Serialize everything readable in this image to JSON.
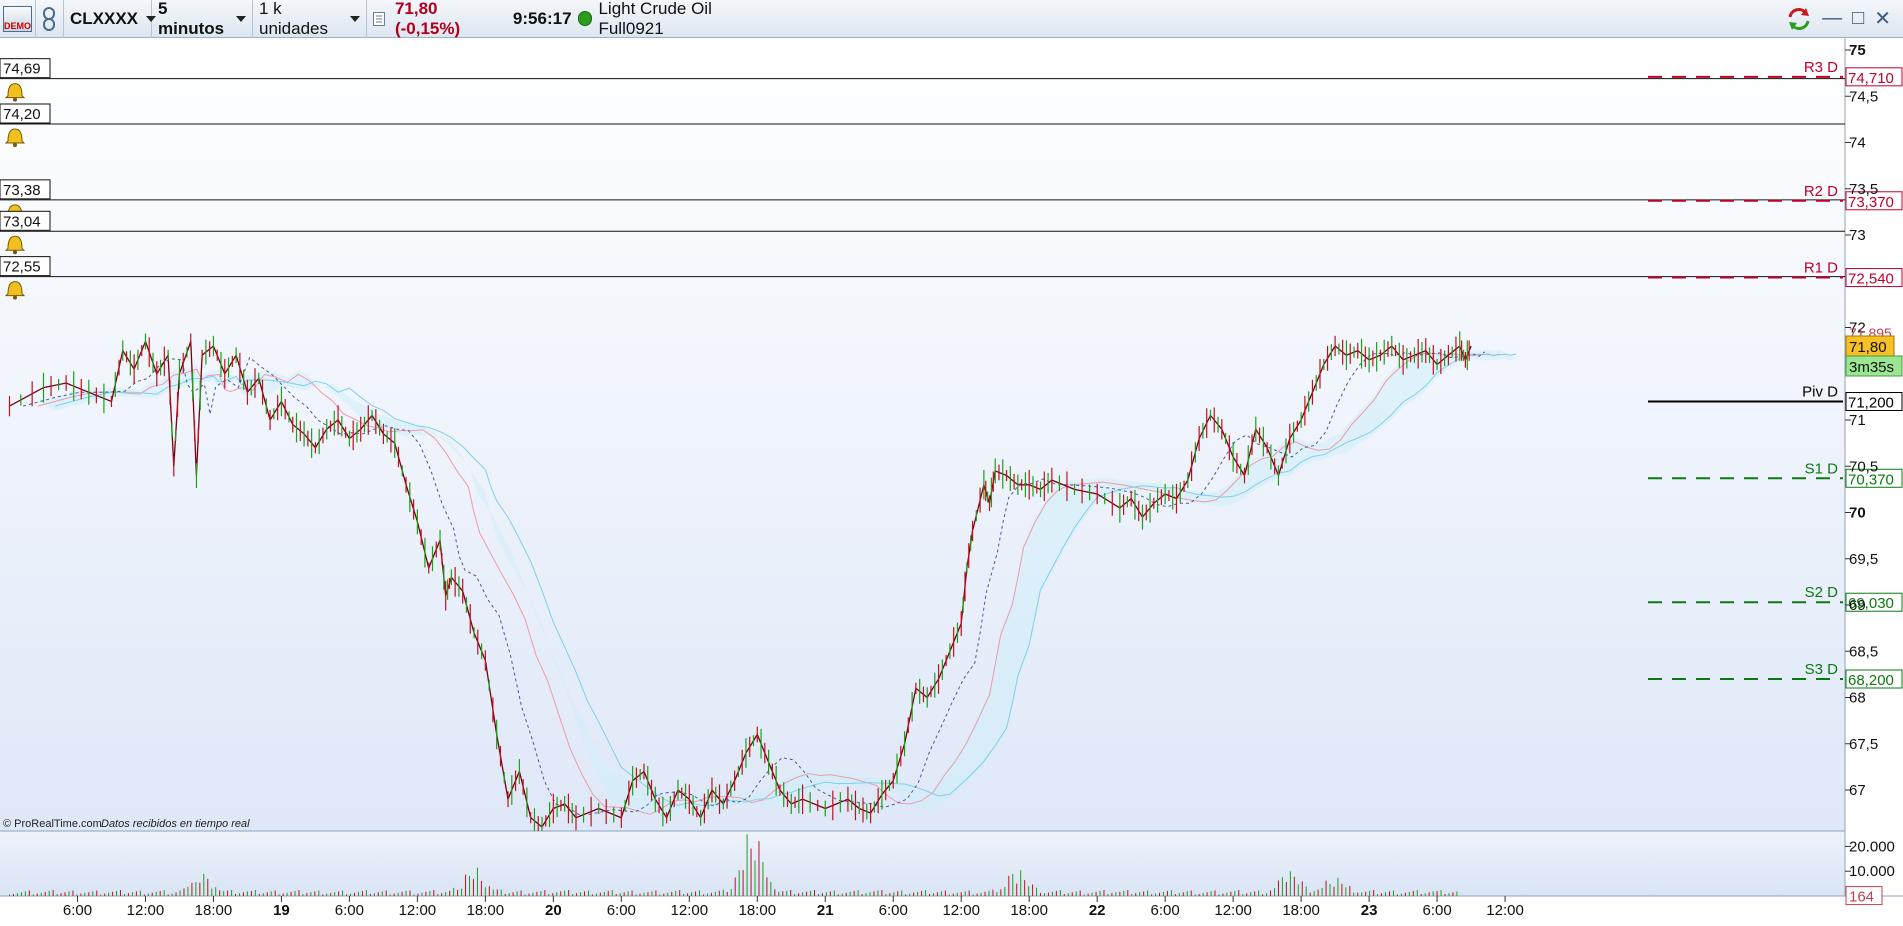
{
  "toolbar": {
    "demo_label": "DEMO",
    "link_icon": "chain-link-icon",
    "instrument": "CLXXXX",
    "timeframe": "5 minutos",
    "units": "1 k unidades",
    "price": "71,80 (-0,15%)",
    "time": "9:56:17",
    "instrument_name": "Light Crude Oil Full0921",
    "window_icons": [
      "refresh-icon",
      "minimize-icon",
      "maximize-icon",
      "close-icon"
    ]
  },
  "attribution": {
    "source": "© ProRealTime.com",
    "status": "Datos recibidos en tiempo real"
  },
  "alerts": [
    {
      "label": "74,69",
      "price": 74.69
    },
    {
      "label": "74,20",
      "price": 74.2
    },
    {
      "label": "73,38",
      "price": 73.38
    },
    {
      "label": "73,04",
      "price": 73.04
    },
    {
      "label": "72,55",
      "price": 72.55
    }
  ],
  "pivots": [
    {
      "name": "R3 D",
      "value_label": "74,710",
      "value": 74.71,
      "color": "#c0002a",
      "style": "dashed"
    },
    {
      "name": "R2 D",
      "value_label": "73,370",
      "value": 73.37,
      "color": "#c0002a",
      "style": "dashed"
    },
    {
      "name": "R1 D",
      "value_label": "72,540",
      "value": 72.54,
      "color": "#c0002a",
      "style": "dashed"
    },
    {
      "name": "Piv D",
      "value_label": "71,200",
      "value": 71.2,
      "color": "#000000",
      "style": "solid"
    },
    {
      "name": "S1 D",
      "value_label": "70,370",
      "value": 70.37,
      "color": "#0a7a10",
      "style": "dashed"
    },
    {
      "name": "S2 D",
      "value_label": "69,030",
      "value": 69.03,
      "color": "#0a7a10",
      "style": "dashed"
    },
    {
      "name": "S3 D",
      "value_label": "68,200",
      "value": 68.2,
      "color": "#0a7a10",
      "style": "dashed"
    }
  ],
  "price_tags": {
    "current": "71,80",
    "countdown": "3m35s",
    "partial_hidden": "71,895"
  },
  "volume_tag": "164",
  "chart_data": {
    "type": "line",
    "title": "",
    "ylim": [
      66.6,
      75.3
    ],
    "y_ticks": [
      {
        "value": 75,
        "label": "75",
        "bold": true
      },
      {
        "value": 74.5,
        "label": "74,5"
      },
      {
        "value": 74,
        "label": "74"
      },
      {
        "value": 73.5,
        "label": "73,5"
      },
      {
        "value": 73,
        "label": "73"
      },
      {
        "value": 72,
        "label": "72"
      },
      {
        "value": 71,
        "label": "71"
      },
      {
        "value": 70.5,
        "label": "70,5"
      },
      {
        "value": 70,
        "label": "70",
        "bold": true
      },
      {
        "value": 69.5,
        "label": "69,5"
      },
      {
        "value": 69,
        "label": "69"
      },
      {
        "value": 68.5,
        "label": "68,5"
      },
      {
        "value": 68,
        "label": "68"
      },
      {
        "value": 67.5,
        "label": "67,5"
      },
      {
        "value": 67,
        "label": "67"
      }
    ],
    "volume_ticks": [
      {
        "value": 20000,
        "label": "20.000"
      },
      {
        "value": 10000,
        "label": "10.000"
      }
    ],
    "volume_max": 25000,
    "x_range": [
      0,
      134
    ],
    "x_ticks": [
      {
        "hour": 6,
        "label": "6:00"
      },
      {
        "hour": 12,
        "label": "12:00"
      },
      {
        "hour": 18,
        "label": "18:00"
      },
      {
        "hour": 24,
        "label": "19",
        "bold": true
      },
      {
        "hour": 30,
        "label": "6:00"
      },
      {
        "hour": 36,
        "label": "12:00"
      },
      {
        "hour": 42,
        "label": "18:00"
      },
      {
        "hour": 48,
        "label": "20",
        "bold": true
      },
      {
        "hour": 54,
        "label": "6:00"
      },
      {
        "hour": 60,
        "label": "12:00"
      },
      {
        "hour": 66,
        "label": "18:00"
      },
      {
        "hour": 72,
        "label": "21",
        "bold": true
      },
      {
        "hour": 78,
        "label": "6:00"
      },
      {
        "hour": 84,
        "label": "12:00"
      },
      {
        "hour": 90,
        "label": "18:00"
      },
      {
        "hour": 96,
        "label": "22",
        "bold": true
      },
      {
        "hour": 102,
        "label": "6:00"
      },
      {
        "hour": 108,
        "label": "12:00"
      },
      {
        "hour": 114,
        "label": "18:00"
      },
      {
        "hour": 120,
        "label": "23",
        "bold": true
      },
      {
        "hour": 126,
        "label": "6:00"
      },
      {
        "hour": 132,
        "label": "12:00"
      }
    ],
    "price_path": [
      [
        0,
        71.15
      ],
      [
        3,
        71.35
      ],
      [
        5,
        71.4
      ],
      [
        7,
        71.3
      ],
      [
        9,
        71.2
      ],
      [
        10,
        71.75
      ],
      [
        11,
        71.55
      ],
      [
        12,
        71.85
      ],
      [
        13,
        71.5
      ],
      [
        14,
        71.7
      ],
      [
        14.5,
        70.5
      ],
      [
        15,
        71.5
      ],
      [
        16,
        71.85
      ],
      [
        16.5,
        70.4
      ],
      [
        17,
        71.7
      ],
      [
        18,
        71.8
      ],
      [
        19,
        71.5
      ],
      [
        20,
        71.7
      ],
      [
        21,
        71.3
      ],
      [
        22,
        71.45
      ],
      [
        23,
        71.0
      ],
      [
        24,
        71.2
      ],
      [
        25,
        70.95
      ],
      [
        26,
        70.85
      ],
      [
        27,
        70.7
      ],
      [
        28,
        70.9
      ],
      [
        29,
        71.0
      ],
      [
        30,
        70.8
      ],
      [
        31,
        70.9
      ],
      [
        32,
        71.05
      ],
      [
        33,
        70.85
      ],
      [
        34,
        70.75
      ],
      [
        35,
        70.3
      ],
      [
        36,
        69.9
      ],
      [
        37,
        69.4
      ],
      [
        38,
        69.7
      ],
      [
        38.5,
        69.1
      ],
      [
        39,
        69.3
      ],
      [
        40,
        69.15
      ],
      [
        41,
        68.7
      ],
      [
        42,
        68.4
      ],
      [
        43,
        67.6
      ],
      [
        44,
        66.9
      ],
      [
        45,
        67.2
      ],
      [
        46,
        66.7
      ],
      [
        47,
        66.6
      ],
      [
        48,
        66.8
      ],
      [
        49,
        66.85
      ],
      [
        50,
        66.7
      ],
      [
        52,
        66.8
      ],
      [
        54,
        66.7
      ],
      [
        55,
        67.1
      ],
      [
        56,
        67.2
      ],
      [
        57,
        66.9
      ],
      [
        58,
        66.7
      ],
      [
        59,
        67.0
      ],
      [
        60,
        66.9
      ],
      [
        61,
        66.7
      ],
      [
        62,
        67.0
      ],
      [
        63,
        66.85
      ],
      [
        64,
        67.1
      ],
      [
        65,
        67.4
      ],
      [
        66,
        67.6
      ],
      [
        67,
        67.3
      ],
      [
        68,
        67.0
      ],
      [
        69,
        66.85
      ],
      [
        70,
        66.9
      ],
      [
        72,
        66.8
      ],
      [
        74,
        66.9
      ],
      [
        75,
        66.8
      ],
      [
        76,
        66.75
      ],
      [
        77,
        66.95
      ],
      [
        78,
        67.1
      ],
      [
        79,
        67.5
      ],
      [
        80,
        68.1
      ],
      [
        81,
        68.0
      ],
      [
        82,
        68.2
      ],
      [
        83,
        68.5
      ],
      [
        84,
        68.8
      ],
      [
        84.5,
        69.4
      ],
      [
        85,
        69.8
      ],
      [
        86,
        70.3
      ],
      [
        86.5,
        70.1
      ],
      [
        87,
        70.45
      ],
      [
        88,
        70.4
      ],
      [
        89,
        70.3
      ],
      [
        90,
        70.3
      ],
      [
        91,
        70.25
      ],
      [
        92,
        70.35
      ],
      [
        94,
        70.25
      ],
      [
        96,
        70.2
      ],
      [
        98,
        70.05
      ],
      [
        99,
        70.15
      ],
      [
        100,
        69.95
      ],
      [
        101,
        70.1
      ],
      [
        102,
        70.2
      ],
      [
        103,
        70.15
      ],
      [
        104,
        70.35
      ],
      [
        105,
        70.8
      ],
      [
        106,
        71.05
      ],
      [
        107,
        70.9
      ],
      [
        108,
        70.6
      ],
      [
        109,
        70.4
      ],
      [
        110,
        70.9
      ],
      [
        111,
        70.7
      ],
      [
        112,
        70.4
      ],
      [
        113,
        70.8
      ],
      [
        114,
        71.0
      ],
      [
        115,
        71.3
      ],
      [
        116,
        71.6
      ],
      [
        117,
        71.8
      ],
      [
        118,
        71.7
      ],
      [
        119,
        71.75
      ],
      [
        120,
        71.65
      ],
      [
        121,
        71.7
      ],
      [
        122,
        71.8
      ],
      [
        123,
        71.65
      ],
      [
        124,
        71.7
      ],
      [
        125,
        71.75
      ],
      [
        126,
        71.6
      ],
      [
        127,
        71.7
      ],
      [
        128,
        71.8
      ],
      [
        128.5,
        71.65
      ],
      [
        129,
        71.8
      ]
    ],
    "volume_bursts": [
      {
        "hour": 17,
        "vol": 8000
      },
      {
        "hour": 41,
        "vol": 12000
      },
      {
        "hour": 65,
        "vol": 7000
      },
      {
        "hour": 65.8,
        "vol": 22000
      },
      {
        "hour": 89,
        "vol": 11000
      },
      {
        "hour": 113,
        "vol": 9000
      },
      {
        "hour": 117,
        "vol": 7000
      }
    ]
  }
}
